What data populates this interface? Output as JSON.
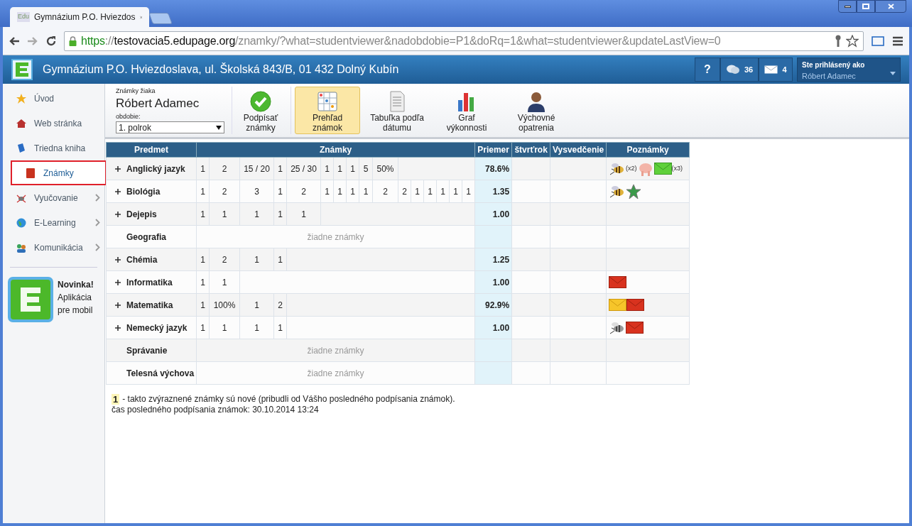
{
  "browser": {
    "tab_title": "Gymnázium P.O. Hviezdos",
    "favicon_text": "Edu",
    "url": {
      "scheme": "https",
      "separator": "://",
      "host": "testovacia5.edupage.org",
      "path": "/znamky/?what=studentviewer&nadobdobie=P1&doRq=1&what=studentviewer&updateLastView=0"
    }
  },
  "header": {
    "school": "Gymnázium P.O. Hviezdoslava, ul. Školská 843/B, 01 432 Dolný Kubín",
    "help": "?",
    "messages_count": "36",
    "mail_count": "4",
    "login_label": "Ste prihlásený ako",
    "user": "Róbert Adamec"
  },
  "sidebar": {
    "items": [
      {
        "label": "Úvod",
        "kind": "star",
        "selected": false,
        "submenu": false
      },
      {
        "label": "Web stránka",
        "kind": "house",
        "selected": false,
        "submenu": false
      },
      {
        "label": "Triedna kniha",
        "kind": "book",
        "selected": false,
        "submenu": false
      },
      {
        "label": "Známky",
        "kind": "grades",
        "selected": true,
        "submenu": false
      },
      {
        "label": "Vyučovanie",
        "kind": "bug",
        "selected": false,
        "submenu": true
      },
      {
        "label": "E-Learning",
        "kind": "globe",
        "selected": false,
        "submenu": true
      },
      {
        "label": "Komunikácia",
        "kind": "people",
        "selected": false,
        "submenu": true
      }
    ],
    "promo": {
      "title": "Novinka!",
      "text": "Aplikácia pre mobil"
    }
  },
  "toolbar": {
    "caption": "Známky žiaka",
    "student": "Róbert Adamec",
    "period_label": "obdobie:",
    "period": "1. polrok",
    "buttons": [
      {
        "label": "Podpísať známky",
        "kind": "check",
        "selected": false
      },
      {
        "label": "Prehľad známok",
        "kind": "grid",
        "selected": true
      },
      {
        "label": "Tabuľka podľa dátumu",
        "kind": "sheet",
        "selected": false
      },
      {
        "label": "Graf výkonnosti",
        "kind": "chart",
        "selected": false
      },
      {
        "label": "Výchovné opatrenia",
        "kind": "person",
        "selected": false
      }
    ]
  },
  "table": {
    "columns": [
      "Predmet",
      "Známky",
      "Priemer",
      "štvrťrok",
      "Vysvedčenie",
      "Poznámky"
    ],
    "rows": [
      {
        "subject": "Anglický jazyk",
        "expandable": true,
        "grades": [
          "1",
          "2",
          "15 / 20",
          "1",
          "25 / 30",
          "1",
          "1",
          "1",
          "5",
          "50%"
        ],
        "average": "78.6%",
        "notes": [
          {
            "kind": "bee",
            "count": "(x2)"
          },
          {
            "kind": "pig"
          },
          {
            "kind": "green-mail",
            "count": "(x3)"
          }
        ]
      },
      {
        "subject": "Biológia",
        "expandable": true,
        "grades": [
          "1",
          "2",
          "3",
          "1",
          "2",
          "1",
          "1",
          "1",
          "1",
          "2",
          "2",
          "1",
          "1",
          "1",
          "1",
          "1"
        ],
        "average": "1.35",
        "notes": [
          {
            "kind": "bee"
          },
          {
            "kind": "star"
          }
        ]
      },
      {
        "subject": "Dejepis",
        "expandable": true,
        "grades": [
          "1",
          "1",
          "1",
          "1",
          "1"
        ],
        "average": "1.00",
        "notes": []
      },
      {
        "subject": "Geografia",
        "expandable": false,
        "empty_text": "žiadne známky"
      },
      {
        "subject": "Chémia",
        "expandable": true,
        "grades": [
          "1",
          "2",
          "1",
          "1"
        ],
        "average": "1.25",
        "notes": []
      },
      {
        "subject": "Informatika",
        "expandable": true,
        "grades": [
          "1",
          "1"
        ],
        "average": "1.00",
        "notes": [
          {
            "kind": "red-mail"
          }
        ]
      },
      {
        "subject": "Matematika",
        "expandable": true,
        "grades": [
          "1",
          "100%",
          "1",
          "2"
        ],
        "average": "92.9%",
        "notes": [
          {
            "kind": "yellow-mail"
          },
          {
            "kind": "red-mail"
          }
        ]
      },
      {
        "subject": "Nemecký jazyk",
        "expandable": true,
        "grades": [
          "1",
          "1",
          "1",
          "1"
        ],
        "average": "1.00",
        "notes": [
          {
            "kind": "grey-bee"
          },
          {
            "kind": "red-mail"
          }
        ]
      },
      {
        "subject": "Správanie",
        "expandable": false,
        "empty_text": "žiadne známky"
      },
      {
        "subject": "Telesná výchova",
        "expandable": false,
        "empty_text": "žiadne známky"
      }
    ]
  },
  "legend": {
    "marker": "1",
    "text": "- takto zvýraznené známky sú nové (pribudli od Vášho posledného podpísania známok).",
    "last_signed": "čas posledného podpísania známok: 30.10.2014 13:24"
  }
}
